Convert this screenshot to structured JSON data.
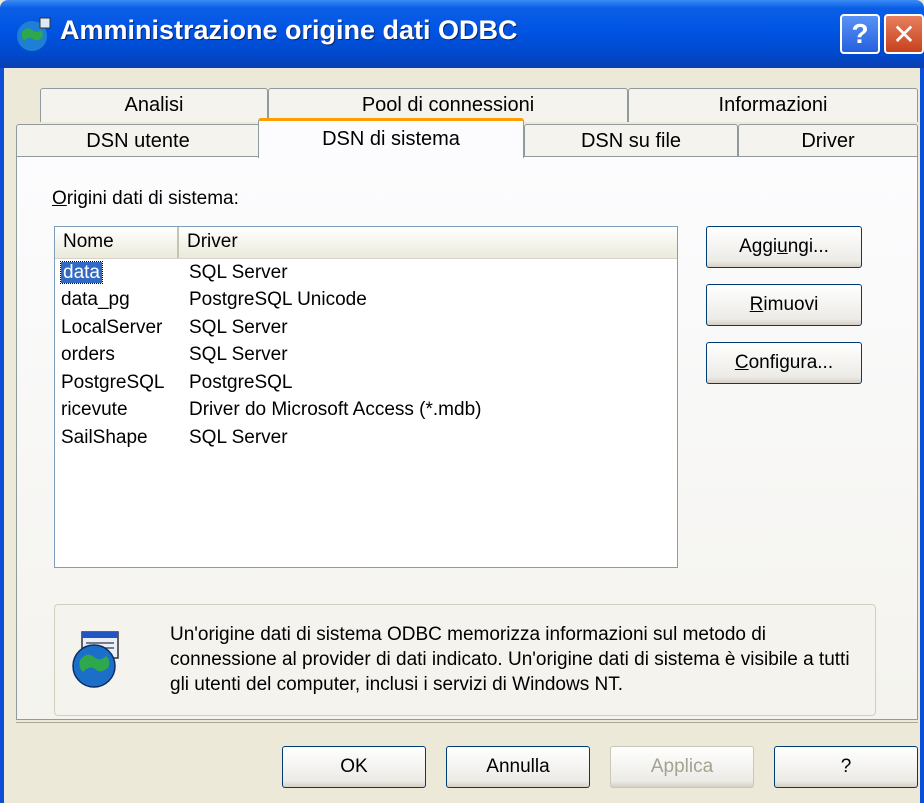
{
  "window": {
    "title": "Amministrazione origine dati ODBC",
    "help_glyph": "?",
    "close_glyph": "✕"
  },
  "tabs_row1": [
    {
      "label": "Analisi"
    },
    {
      "label": "Pool di connessioni"
    },
    {
      "label": "Informazioni"
    }
  ],
  "tabs_row2": [
    {
      "label": "DSN utente"
    },
    {
      "label": "DSN di sistema",
      "active": true
    },
    {
      "label": "DSN su file"
    },
    {
      "label": "Driver"
    }
  ],
  "section": {
    "label_first": "O",
    "label_rest": "rigini dati di sistema:"
  },
  "list": {
    "columns": [
      "Nome",
      "Driver"
    ],
    "rows": [
      {
        "name": "data",
        "driver": "SQL Server",
        "selected": true
      },
      {
        "name": "data_pg",
        "driver": "PostgreSQL Unicode"
      },
      {
        "name": "LocalServer",
        "driver": "SQL Server"
      },
      {
        "name": "orders",
        "driver": "SQL Server"
      },
      {
        "name": "PostgreSQL",
        "driver": "PostgreSQL"
      },
      {
        "name": "ricevute",
        "driver": "Driver do Microsoft Access (*.mdb)"
      },
      {
        "name": "SailShape",
        "driver": "SQL Server"
      }
    ]
  },
  "side_buttons": {
    "add_pre": "Aggi",
    "add_key": "u",
    "add_post": "ngi...",
    "remove_key": "R",
    "remove_post": "imuovi",
    "config_key": "C",
    "config_post": "onfigura..."
  },
  "info": {
    "text": "Un'origine dati di sistema ODBC memorizza informazioni sul metodo di connessione al provider di dati indicato. Un'origine dati di sistema è visibile a tutti gli utenti del computer, inclusi i servizi di Windows NT."
  },
  "footer_buttons": {
    "ok": "OK",
    "cancel": "Annulla",
    "apply": "Applica",
    "help": "?"
  },
  "colors": {
    "titlebar": "#0054e3",
    "selection": "#316ac5",
    "tab_highlight": "#ff9c00"
  }
}
